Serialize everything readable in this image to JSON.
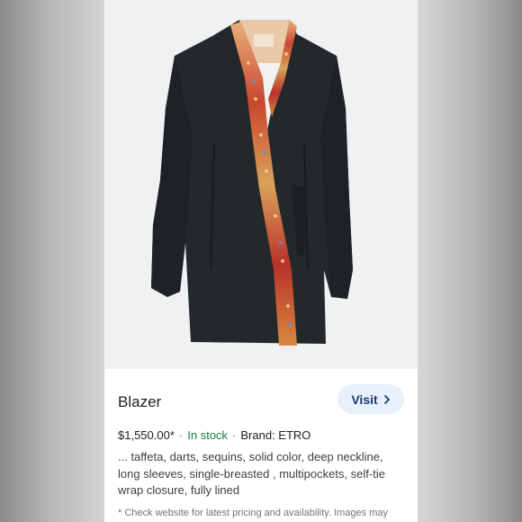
{
  "product": {
    "image_alt": "Black wrap blazer with embroidered sequin trim",
    "title": "Blazer",
    "visit_label": "Visit",
    "price": "$1,550.00*",
    "separator": "·",
    "stock": "In stock",
    "brand": "Brand: ETRO",
    "description": "... taffeta, darts, sequins, solid color, deep neckline, long sleeves, single-breasted , multipockets, self-tie wrap closure, fully lined",
    "note": "* Check website for latest pricing and availability. Images may"
  },
  "colors": {
    "accent": "#1a73e8",
    "visit_bg": "#e8f0fe",
    "in_stock": "#188038",
    "garment": "#23282a"
  },
  "icons": [
    "chevron-right-icon"
  ]
}
